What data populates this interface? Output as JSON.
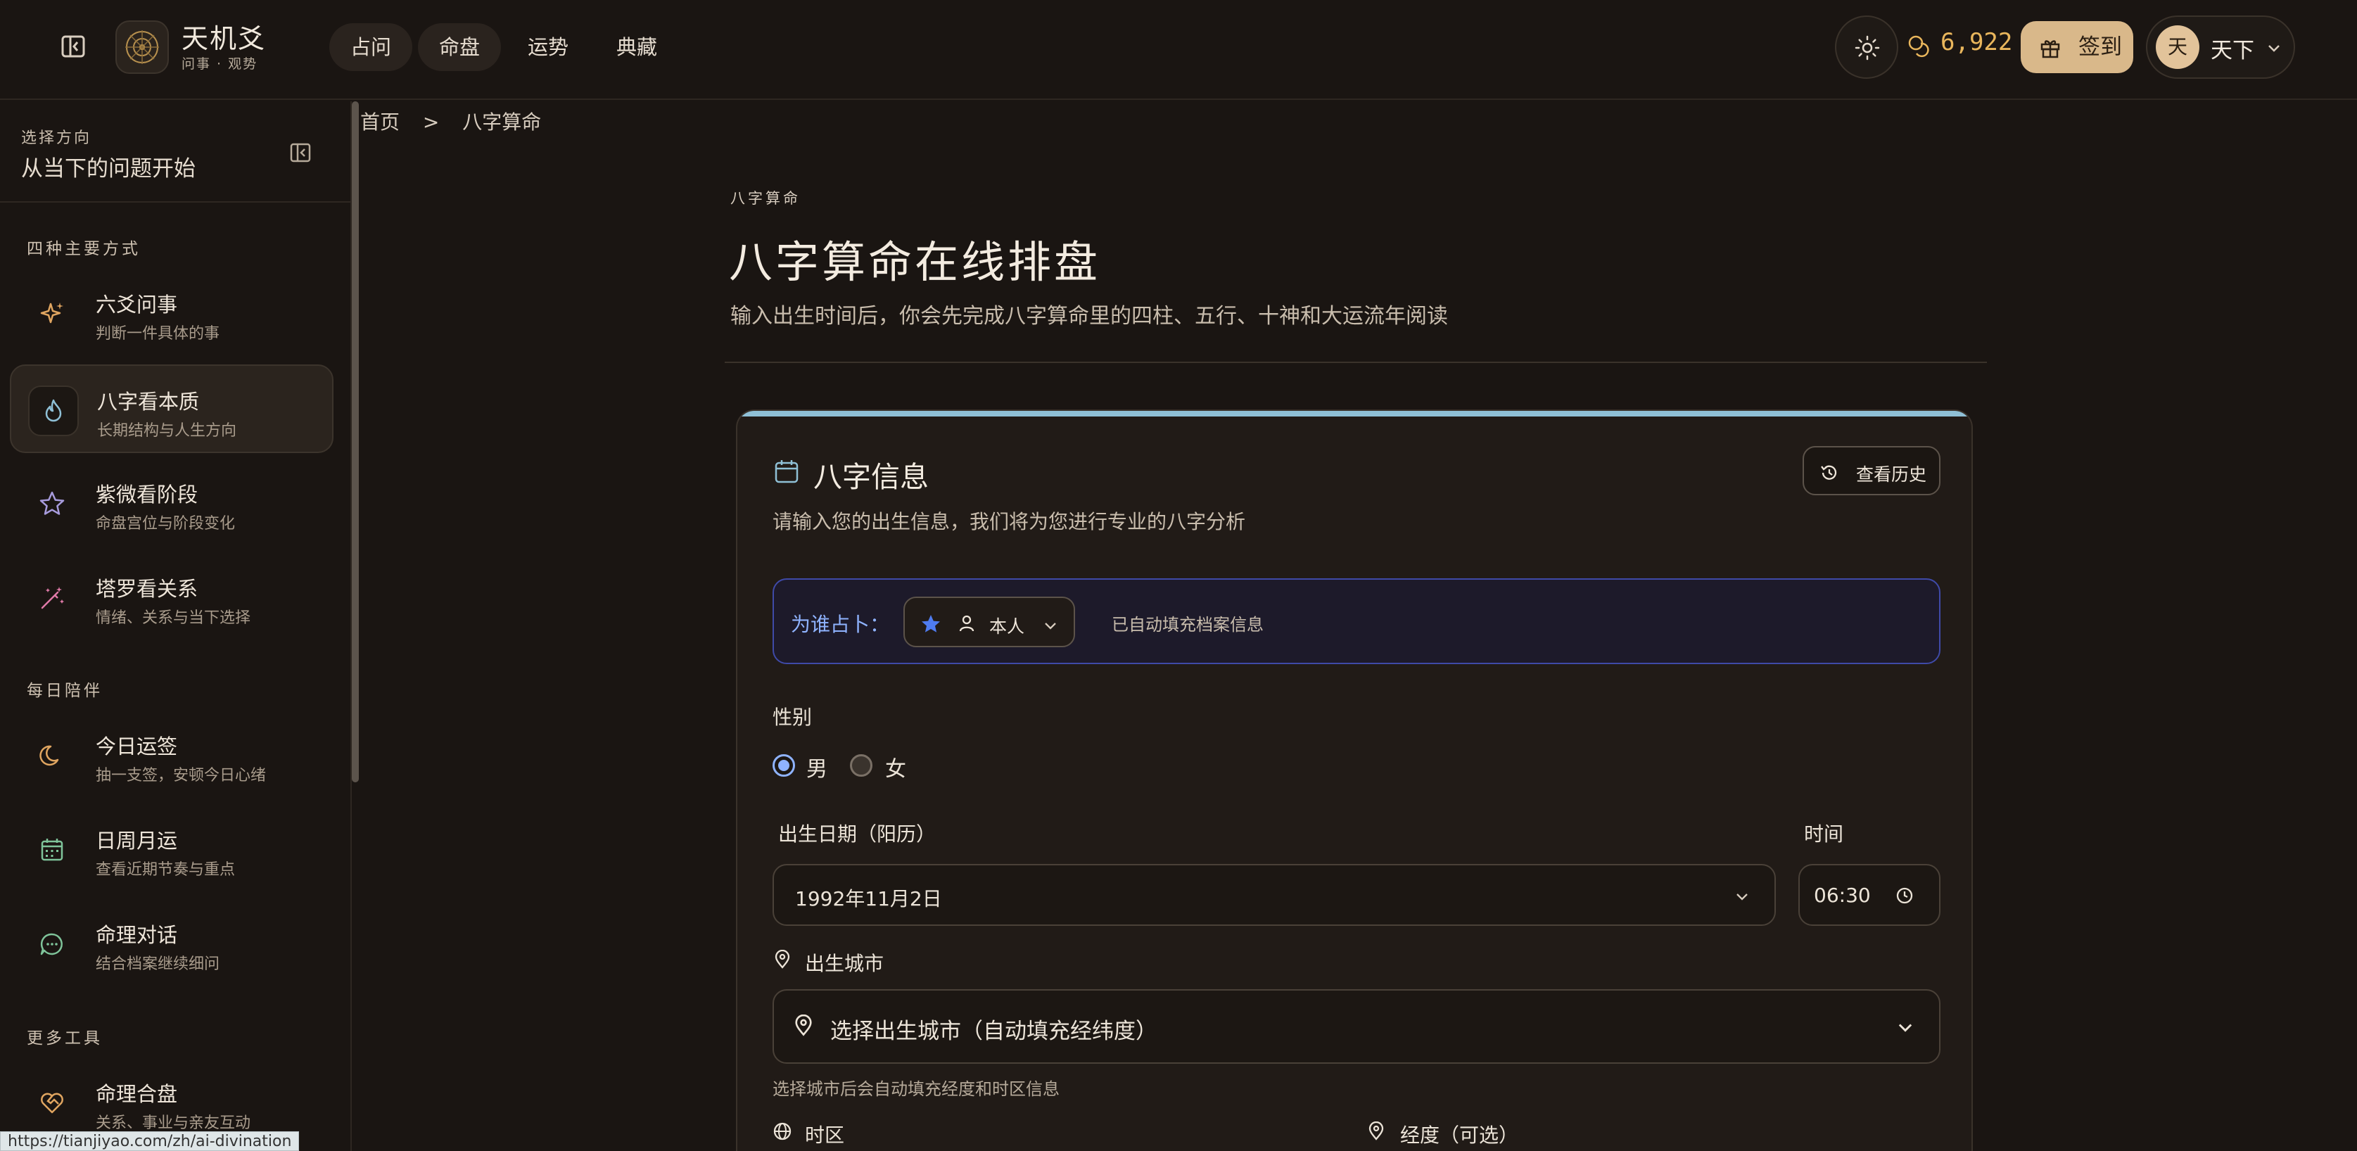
{
  "header": {
    "app_title": "天机爻",
    "app_subtitle": "问事 · 观势",
    "nav": [
      "占问",
      "命盘",
      "运势",
      "典藏"
    ],
    "active_nav": "命盘",
    "coins": "6,922",
    "checkin_label": "签到",
    "avatar_char": "天",
    "user_name": "天下"
  },
  "sidebar": {
    "kicker": "选择方向",
    "title": "从当下的问题开始",
    "sections": [
      "四种主要方式",
      "每日陪伴",
      "更多工具"
    ],
    "items": [
      {
        "title": "六爻问事",
        "sub": "判断一件具体的事",
        "icon": "sparkle-icon"
      },
      {
        "title": "八字看本质",
        "sub": "长期结构与人生方向",
        "icon": "flame-icon"
      },
      {
        "title": "紫微看阶段",
        "sub": "命盘宫位与阶段变化",
        "icon": "star-icon"
      },
      {
        "title": "塔罗看关系",
        "sub": "情绪、关系与当下选择",
        "icon": "magic-wand-icon"
      },
      {
        "title": "今日运签",
        "sub": "抽一支签，安顿今日心绪",
        "icon": "moon-icon"
      },
      {
        "title": "日周月运",
        "sub": "查看近期节奏与重点",
        "icon": "calendar-icon"
      },
      {
        "title": "命理对话",
        "sub": "结合档案继续细问",
        "icon": "chat-icon"
      },
      {
        "title": "命理合盘",
        "sub": "关系、事业与亲友互动",
        "icon": "heart-handshake-icon"
      }
    ]
  },
  "status_url": "https://tianjiyao.com/zh/ai-divination",
  "breadcrumb": {
    "home": "首页",
    "sep": ">",
    "current": "八字算命"
  },
  "page": {
    "kicker": "八字算命",
    "title": "八字算命在线排盘",
    "desc": "输入出生时间后，你会先完成八字算命里的四柱、五行、十神和大运流年阅读"
  },
  "card": {
    "title": "八字信息",
    "history_label": "查看历史",
    "desc": "请输入您的出生信息，我们将为您进行专业的八字分析",
    "who_label": "为谁占卜：",
    "who_value": "本人",
    "who_hint": "已自动填充档案信息",
    "gender_label": "性别",
    "gender_male": "男",
    "gender_female": "女",
    "birth_date_label": "出生日期（阳历）",
    "birth_date_value": "1992年11月2日",
    "time_label": "时间",
    "time_value": "06:30",
    "city_label": "出生城市",
    "city_placeholder": "选择出生城市（自动填充经纬度）",
    "city_hint": "选择城市后会自动填充经度和时区信息",
    "timezone_label": "时区",
    "longitude_label": "经度（可选）"
  },
  "colors": {
    "accent_gold": "#e9b65c",
    "checkin_bg": "#d9b88a",
    "info_blue": "#8fb3ff",
    "card_accent": "#8fc0d6"
  }
}
